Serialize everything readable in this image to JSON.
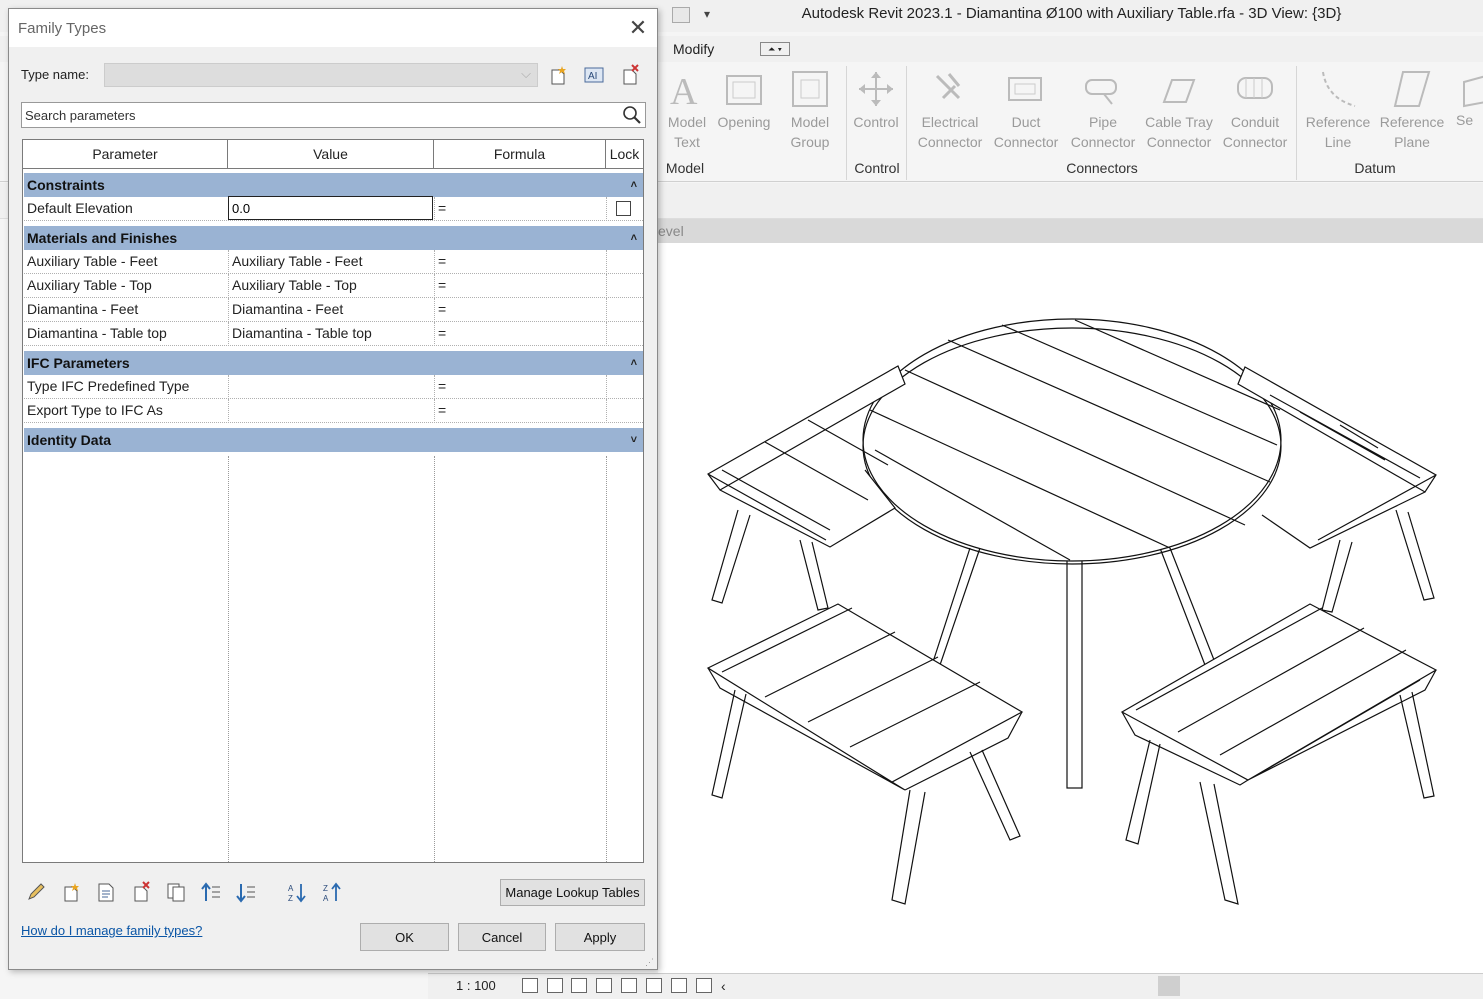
{
  "app": {
    "window_title": "Autodesk Revit 2023.1 - Diamantina Ø100 with Auxiliary Table.rfa - 3D View: {3D}",
    "tabs": [
      "Modify"
    ],
    "ribbon": {
      "model_panel": {
        "label": "Model",
        "buttons": [
          {
            "label1": "Model",
            "label2": "Text"
          },
          {
            "label1": "Opening",
            "label2": ""
          },
          {
            "label1": "Model",
            "label2": "Group"
          }
        ]
      },
      "control_panel": {
        "label": "Control",
        "buttons": [
          {
            "label1": "Control",
            "label2": ""
          }
        ]
      },
      "connectors_panel": {
        "label": "Connectors",
        "buttons": [
          {
            "label1": "Electrical",
            "label2": "Connector"
          },
          {
            "label1": "Duct",
            "label2": "Connector"
          },
          {
            "label1": "Pipe",
            "label2": "Connector"
          },
          {
            "label1": "Cable Tray",
            "label2": "Connector"
          },
          {
            "label1": "Conduit",
            "label2": "Connector"
          }
        ]
      },
      "datum_panel": {
        "label": "Datum",
        "buttons": [
          {
            "label1": "Reference",
            "label2": "Line"
          },
          {
            "label1": "Reference",
            "label2": "Plane"
          },
          {
            "label1": "Se",
            "label2": ""
          }
        ]
      }
    },
    "view_header": "evel",
    "view_bar": {
      "scale": "1 : 100"
    }
  },
  "dialog": {
    "title": "Family Types",
    "type_name_label": "Type name:",
    "type_name_value": "",
    "search_placeholder": "Search parameters",
    "columns": [
      "Parameter",
      "Value",
      "Formula",
      "Lock"
    ],
    "groups": {
      "constraints": {
        "name": "Constraints",
        "rows": [
          {
            "param": "Default Elevation",
            "value": "0.0",
            "formula": "="
          }
        ]
      },
      "materials": {
        "name": "Materials and Finishes",
        "rows": [
          {
            "param": "Auxiliary Table - Feet",
            "value": "Auxiliary Table - Feet",
            "formula": "="
          },
          {
            "param": "Auxiliary Table - Top",
            "value": "Auxiliary Table - Top",
            "formula": "="
          },
          {
            "param": "Diamantina - Feet",
            "value": "Diamantina - Feet",
            "formula": "="
          },
          {
            "param": "Diamantina - Table top",
            "value": "Diamantina - Table top",
            "formula": "="
          }
        ]
      },
      "ifc": {
        "name": "IFC Parameters",
        "rows": [
          {
            "param": "Type IFC Predefined Type",
            "value": "",
            "formula": "="
          },
          {
            "param": "Export Type to IFC As",
            "value": "",
            "formula": "="
          }
        ]
      },
      "identity": {
        "name": "Identity Data"
      }
    },
    "collapse_glyph": "˄",
    "expand_glyph": "˅",
    "manage_lookup_label": "Manage Lookup Tables",
    "help_link": "How do I manage family types?",
    "ok_label": "OK",
    "cancel_label": "Cancel",
    "apply_label": "Apply",
    "icons": [
      "pencil-icon",
      "new-parameter-icon",
      "edit-parameter-icon",
      "delete-parameter-icon",
      "copy-icon",
      "move-up-icon",
      "move-down-icon",
      "sort-ascending-icon",
      "sort-descending-icon"
    ]
  }
}
